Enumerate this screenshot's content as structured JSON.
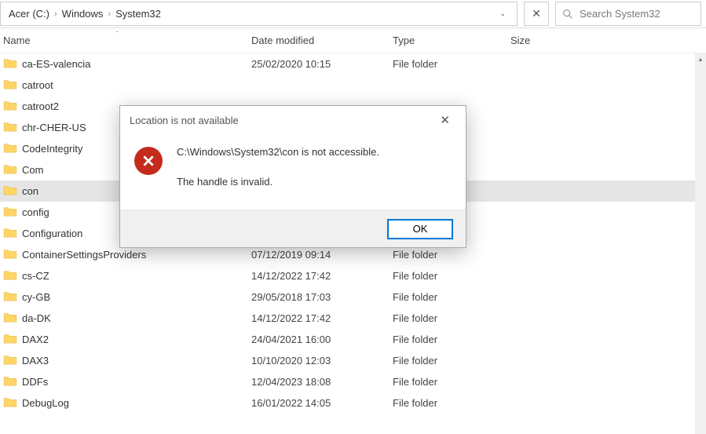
{
  "breadcrumb": {
    "root": "Acer (C:)",
    "seg1": "Windows",
    "seg2": "System32"
  },
  "search": {
    "placeholder": "Search System32"
  },
  "columns": {
    "name": "Name",
    "date": "Date modified",
    "type": "Type",
    "size": "Size"
  },
  "selected_index": 6,
  "rows": [
    {
      "name": "ca-ES-valencia",
      "date": "25/02/2020 10:15",
      "type": "File folder"
    },
    {
      "name": "catroot",
      "date": "",
      "type": ""
    },
    {
      "name": "catroot2",
      "date": "",
      "type": ""
    },
    {
      "name": "chr-CHER-US",
      "date": "",
      "type": ""
    },
    {
      "name": "CodeIntegrity",
      "date": "",
      "type": ""
    },
    {
      "name": "Com",
      "date": "",
      "type": ""
    },
    {
      "name": "con",
      "date": "",
      "type": ""
    },
    {
      "name": "config",
      "date": "",
      "type": ""
    },
    {
      "name": "Configuration",
      "date": "",
      "type": ""
    },
    {
      "name": "ContainerSettingsProviders",
      "date": "07/12/2019 09:14",
      "type": "File folder"
    },
    {
      "name": "cs-CZ",
      "date": "14/12/2022 17:42",
      "type": "File folder"
    },
    {
      "name": "cy-GB",
      "date": "29/05/2018 17:03",
      "type": "File folder"
    },
    {
      "name": "da-DK",
      "date": "14/12/2022 17:42",
      "type": "File folder"
    },
    {
      "name": "DAX2",
      "date": "24/04/2021 16:00",
      "type": "File folder"
    },
    {
      "name": "DAX3",
      "date": "10/10/2020 12:03",
      "type": "File folder"
    },
    {
      "name": "DDFs",
      "date": "12/04/2023 18:08",
      "type": "File folder"
    },
    {
      "name": "DebugLog",
      "date": "16/01/2022 14:05",
      "type": "File folder"
    }
  ],
  "dialog": {
    "title": "Location is not available",
    "line1": "C:\\Windows\\System32\\con is not accessible.",
    "line2": "The handle is invalid.",
    "ok": "OK"
  }
}
